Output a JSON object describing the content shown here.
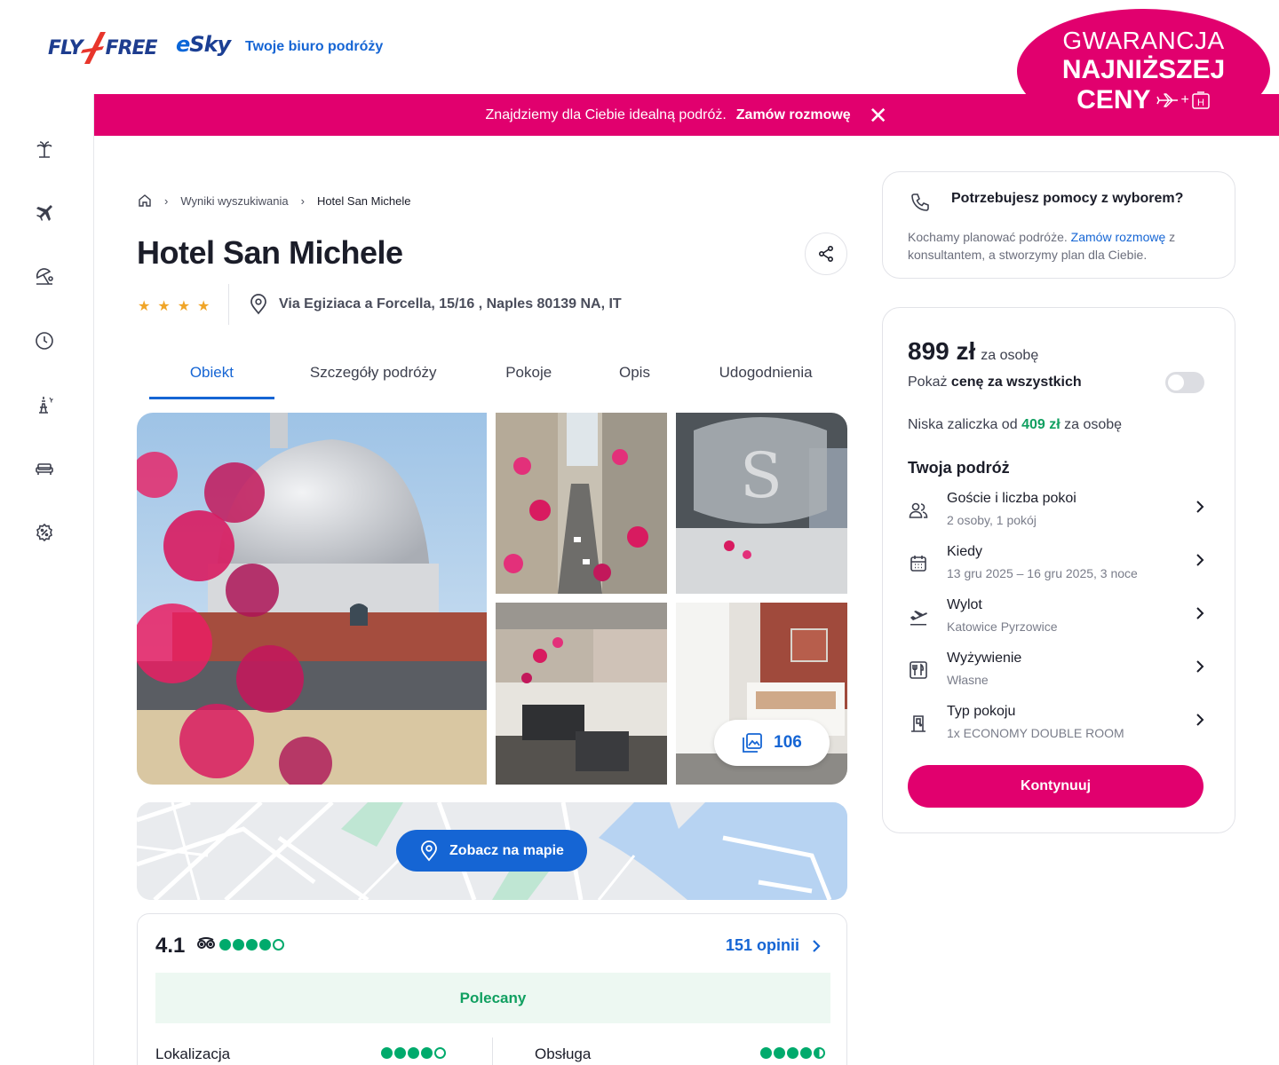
{
  "header": {
    "logo_fly_left": "FLY",
    "logo_fly_right": "FREE",
    "logo_esky_e": "e",
    "logo_esky_rest": "Sky",
    "tagline": "Twoje biuro podróży"
  },
  "guarantee": {
    "line1": "GWARANCJA",
    "line2": "NAJNIŻSZEJ",
    "line3": "CENY",
    "plus": "+",
    "hotel_letter": "H"
  },
  "banner": {
    "text": "Znajdziemy dla Ciebie idealną podróż.",
    "link": "Zamów rozmowę",
    "close": "✕"
  },
  "sidebar": {
    "icons": [
      "palm-tree-icon",
      "plane-icon",
      "beach-icon",
      "clock-icon",
      "eiffel-tower-icon",
      "sofa-icon",
      "discount-icon"
    ]
  },
  "breadcrumb": {
    "items": [
      "Wyniki wyszukiwania",
      "Hotel San Michele"
    ],
    "separator": "›"
  },
  "hotel": {
    "name": "Hotel San Michele",
    "stars": 4,
    "star_glyph": "★",
    "address": "Via Egiziaca a Forcella, 15/16 , Naples 80139 NA, IT"
  },
  "tabs": [
    {
      "label": "Obiekt",
      "active": true
    },
    {
      "label": "Szczegóły podróży",
      "active": false
    },
    {
      "label": "Pokoje",
      "active": false
    },
    {
      "label": "Opis",
      "active": false
    },
    {
      "label": "Udogodnienia",
      "active": false
    }
  ],
  "gallery": {
    "photo_count": "106"
  },
  "map": {
    "button_label": "Zobacz na mapie"
  },
  "reviews": {
    "score": "4.1",
    "bubbles": 4,
    "count_label": "151 opinii",
    "badge": "Polecany",
    "aspects": [
      {
        "label": "Lokalizacja",
        "rating": 4
      },
      {
        "label": "Obsługa",
        "rating": 4.5
      }
    ]
  },
  "help": {
    "title": "Potrzebujesz pomocy z wyborem?",
    "text_before": "Kochamy planować podróże.",
    "link": "Zamów rozmowę",
    "text_after": "z konsultantem, a stworzymy plan dla Ciebie."
  },
  "price": {
    "amount": "899 zł",
    "per_person": "za osobę",
    "toggle_prefix": "Pokaż",
    "toggle_bold": "cenę za wszystkich",
    "toggle_on": false,
    "deposit_prefix": "Niska zaliczka od",
    "deposit_amount": "409 zł",
    "deposit_suffix": "za osobę",
    "trip_title": "Twoja podróż",
    "trip_rows": [
      {
        "icon": "guests-icon",
        "label": "Goście i liczba pokoi",
        "value": "2 osoby, 1 pokój"
      },
      {
        "icon": "calendar-icon",
        "label": "Kiedy",
        "value": "13 gru 2025 – 16 gru 2025, 3 noce"
      },
      {
        "icon": "departure-icon",
        "label": "Wylot",
        "value": "Katowice Pyrzowice"
      },
      {
        "icon": "meal-icon",
        "label": "Wyżywienie",
        "value": "Własne"
      },
      {
        "icon": "room-icon",
        "label": "Typ pokoju",
        "value": "1x ECONOMY DOUBLE ROOM"
      }
    ],
    "continue_label": "Kontynuuj"
  },
  "colors": {
    "brand_pink": "#e1006e",
    "link_blue": "#1565d4",
    "green": "#11a061",
    "tripadvisor_green": "#00aa6c"
  }
}
